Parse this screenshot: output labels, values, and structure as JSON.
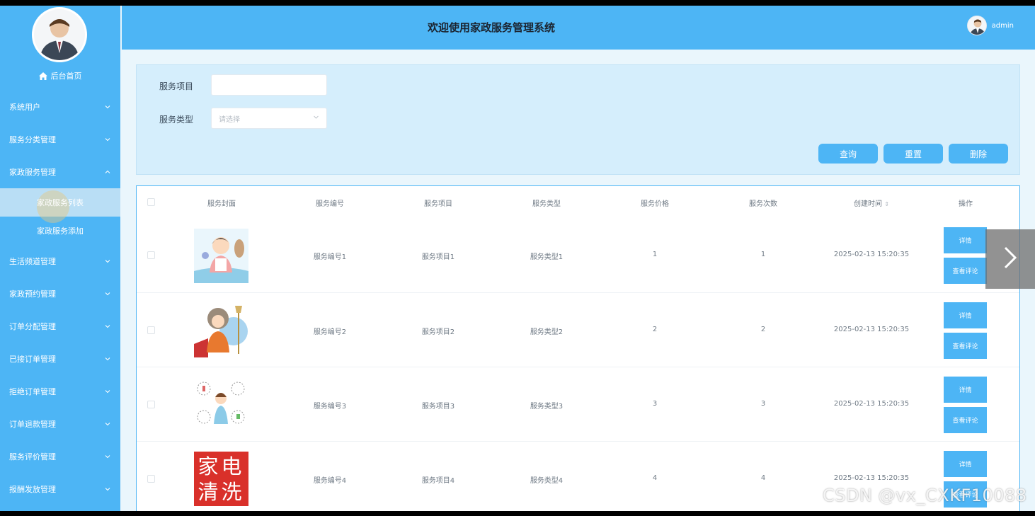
{
  "header": {
    "title": "欢迎使用家政服务管理系统",
    "username": "admin"
  },
  "sidebar": {
    "home_label": "后台首页",
    "items": [
      {
        "label": "系统用户"
      },
      {
        "label": "服务分类管理"
      },
      {
        "label": "家政服务管理",
        "expanded": true,
        "children": [
          {
            "label": "家政服务列表",
            "active": true
          },
          {
            "label": "家政服务添加"
          }
        ]
      },
      {
        "label": "生活频道管理"
      },
      {
        "label": "家政预约管理"
      },
      {
        "label": "订单分配管理"
      },
      {
        "label": "已接订单管理"
      },
      {
        "label": "拒绝订单管理"
      },
      {
        "label": "订单退款管理"
      },
      {
        "label": "服务评价管理"
      },
      {
        "label": "报酬发放管理"
      }
    ]
  },
  "search": {
    "item_label": "服务项目",
    "item_value": "",
    "type_label": "服务类型",
    "type_placeholder": "请选择",
    "query_btn": "查询",
    "reset_btn": "重置",
    "delete_btn": "删除"
  },
  "table": {
    "headers": [
      "服务封面",
      "服务编号",
      "服务项目",
      "服务类型",
      "服务价格",
      "服务次数",
      "创建时间",
      "操作"
    ],
    "rows": [
      {
        "code": "服务编号1",
        "item": "服务项目1",
        "type": "服务类型1",
        "price": "1",
        "count": "1",
        "created": "2025-02-13 15:20:35",
        "cover_text": ""
      },
      {
        "code": "服务编号2",
        "item": "服务项目2",
        "type": "服务类型2",
        "price": "2",
        "count": "2",
        "created": "2025-02-13 15:20:35",
        "cover_text": ""
      },
      {
        "code": "服务编号3",
        "item": "服务项目3",
        "type": "服务类型3",
        "price": "3",
        "count": "3",
        "created": "2025-02-13 15:20:35",
        "cover_text": ""
      },
      {
        "code": "服务编号4",
        "item": "服务项目4",
        "type": "服务类型4",
        "price": "4",
        "count": "4",
        "created": "2025-02-13 15:20:35",
        "cover_text": "家电清洗"
      }
    ],
    "detail_btn": "详情",
    "review_btn": "查看评论"
  },
  "watermark": "CSDN @vx_CXKF10088",
  "colors": {
    "primary": "#4db5f5",
    "panel": "#d5eefc",
    "title": "#1b2430"
  }
}
